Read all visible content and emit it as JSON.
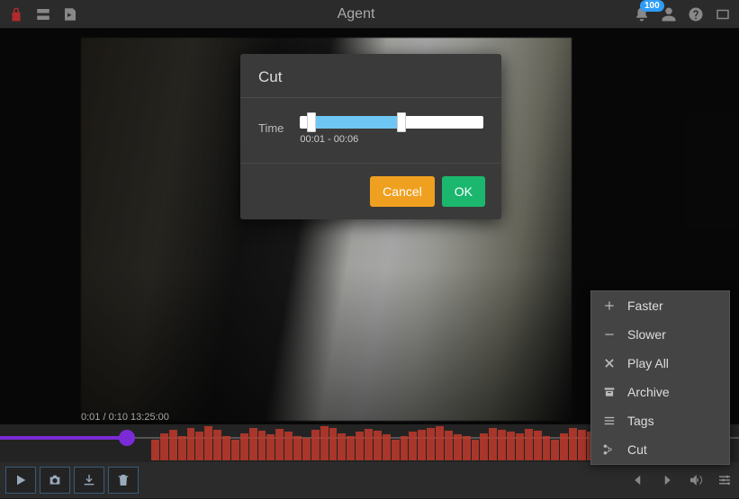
{
  "header": {
    "title": "Agent",
    "notification_count": "100"
  },
  "dialog": {
    "title": "Cut",
    "time_label": "Time",
    "range_text": "00:01 - 00:06",
    "cancel_label": "Cancel",
    "ok_label": "OK"
  },
  "menu": {
    "items": [
      {
        "icon": "plus",
        "label": "Faster"
      },
      {
        "icon": "minus",
        "label": "Slower"
      },
      {
        "icon": "x",
        "label": "Play All"
      },
      {
        "icon": "archive",
        "label": "Archive"
      },
      {
        "icon": "list",
        "label": "Tags"
      },
      {
        "icon": "scissors",
        "label": "Cut"
      }
    ]
  },
  "overlay": {
    "time_text": "0:01 / 0:10 13:25:00"
  },
  "colors": {
    "accent_blue": "#2e9df7",
    "btn_warn": "#f0a020",
    "btn_ok": "#1bb76e",
    "seek": "#7b2bd6",
    "activity": "#c0392b"
  }
}
